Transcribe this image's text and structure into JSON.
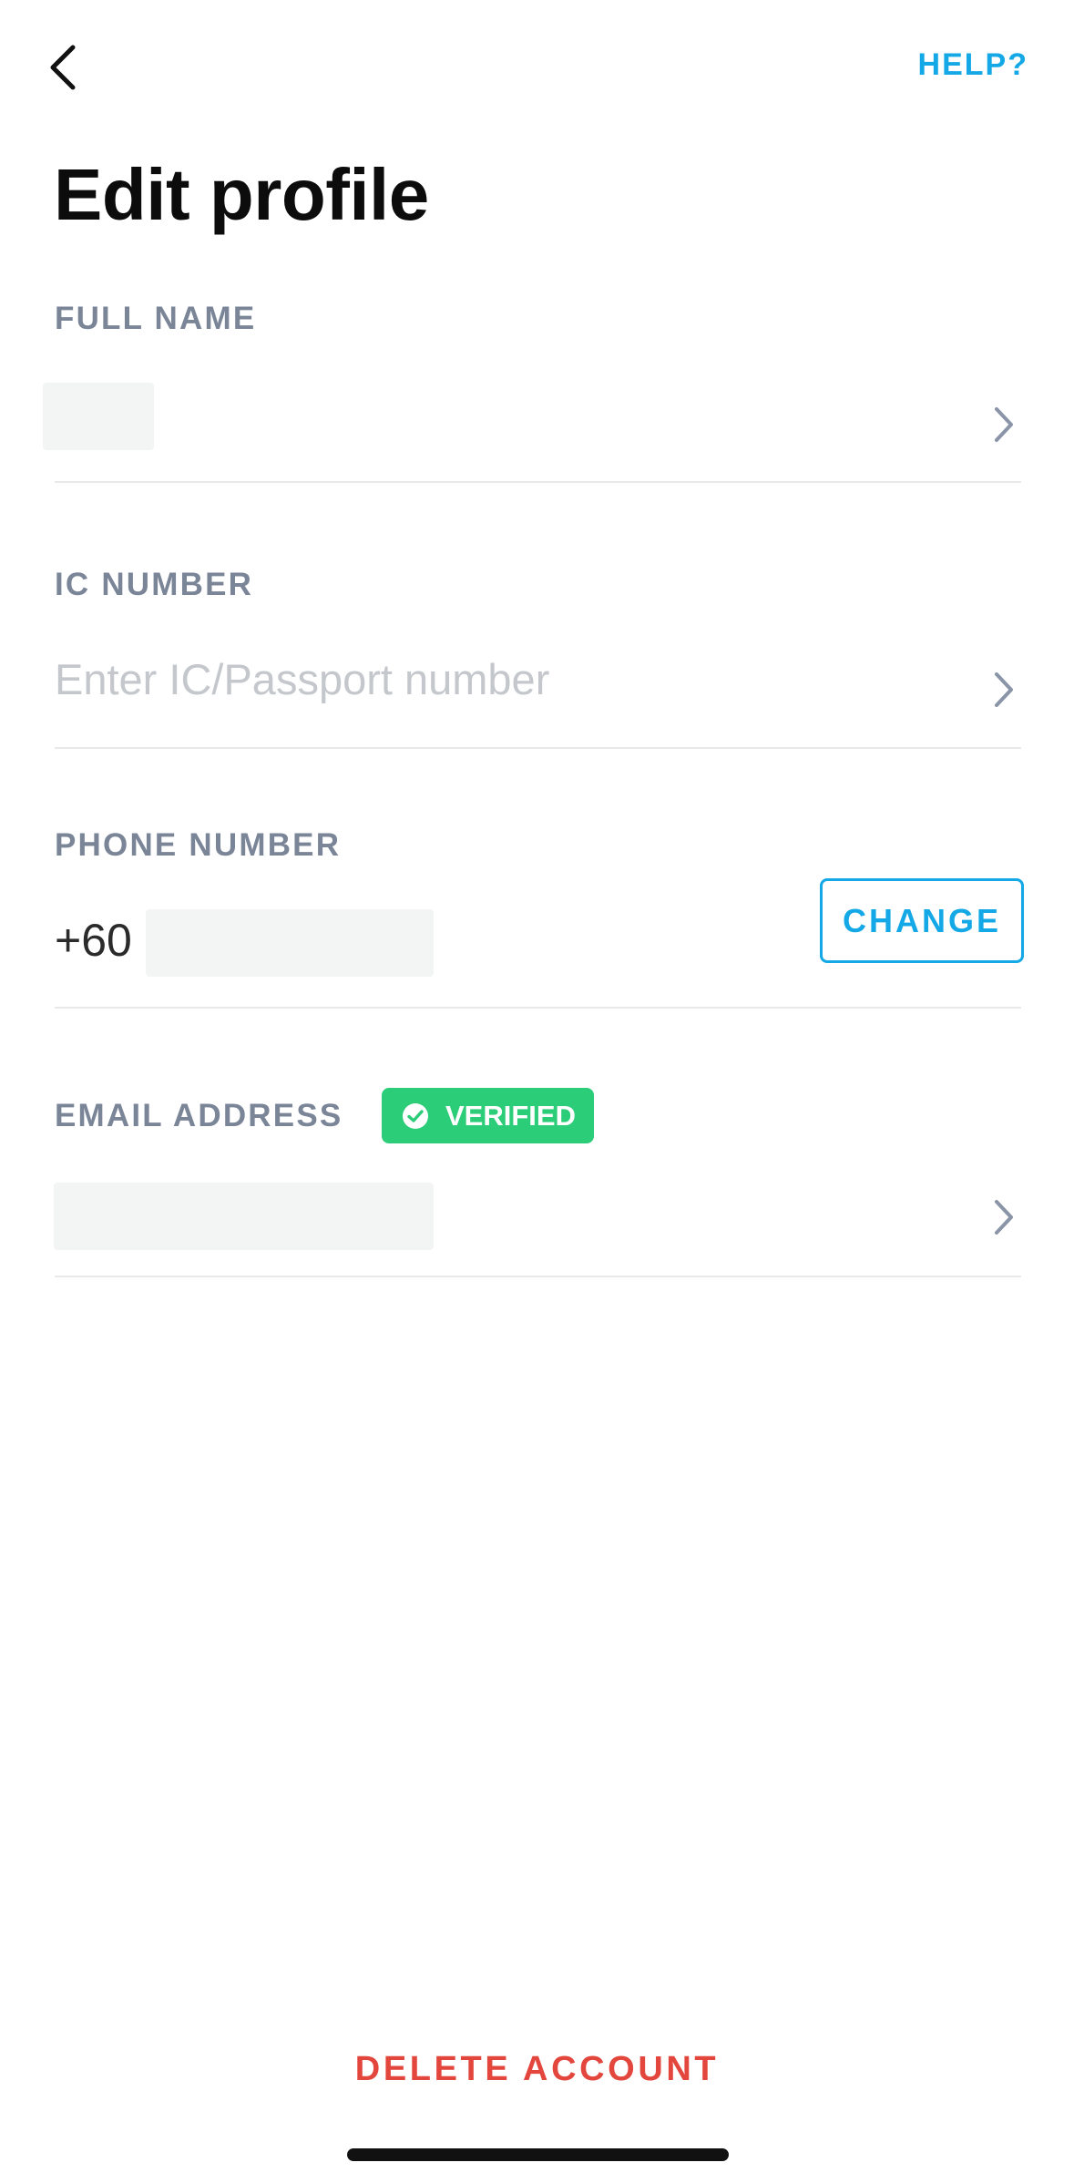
{
  "header": {
    "help_label": "HELP?",
    "title": "Edit profile",
    "back_icon": "chevron-left-icon"
  },
  "fields": {
    "full_name": {
      "label": "FULL NAME",
      "value": "",
      "chevron_icon": "chevron-right-icon"
    },
    "ic_number": {
      "label": "IC NUMBER",
      "placeholder": "Enter IC/Passport number",
      "chevron_icon": "chevron-right-icon"
    },
    "phone_number": {
      "label": "PHONE NUMBER",
      "prefix": "+60",
      "value": "",
      "change_label": "CHANGE"
    },
    "email_address": {
      "label": "EMAIL ADDRESS",
      "badge_label": "VERIFIED",
      "badge_icon": "check-circle-icon",
      "value": "",
      "chevron_icon": "chevron-right-icon"
    }
  },
  "footer": {
    "delete_label": "DELETE ACCOUNT"
  },
  "colors": {
    "accent_blue": "#14a9e6",
    "label_gray": "#7b8598",
    "placeholder_gray": "#c4c7cc",
    "divider": "#e8e9eb",
    "chevron": "#8a95a8",
    "verified_green": "#2ccd79",
    "danger_red": "#e2463d",
    "masked_fill": "#f3f4f4",
    "home_indicator": "#111111"
  }
}
